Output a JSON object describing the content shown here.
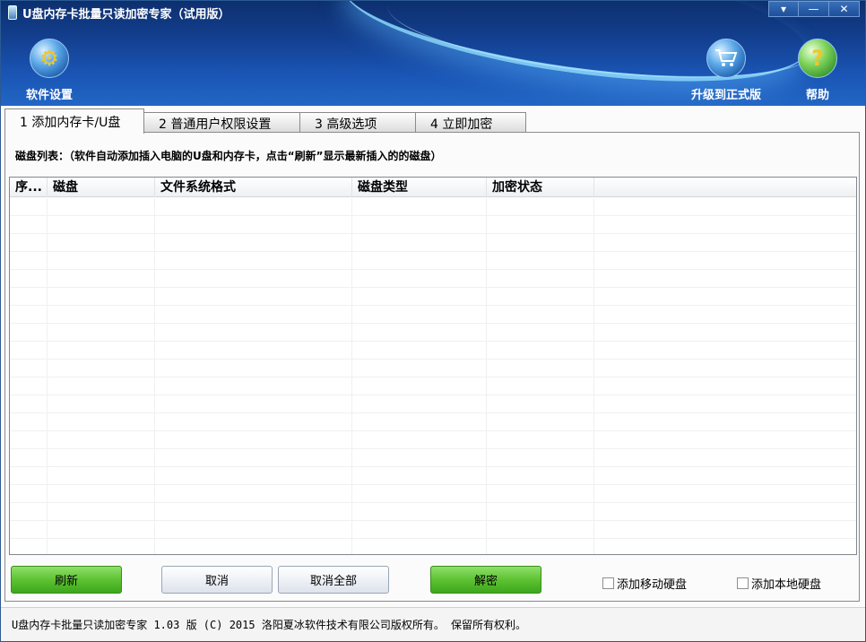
{
  "window": {
    "title": "U盘内存卡批量只读加密专家（试用版）",
    "controls": {
      "menu": "▾",
      "minimize": "—",
      "close": "✕"
    }
  },
  "header": {
    "settings_label": "软件设置",
    "upgrade_label": "升级到正式版",
    "help_label": "帮助"
  },
  "tabs": [
    {
      "label": "1 添加内存卡/U盘"
    },
    {
      "label": "2 普通用户权限设置"
    },
    {
      "label": "3 高级选项"
    },
    {
      "label": "4 立即加密"
    }
  ],
  "panel": {
    "caption": "磁盘列表：（软件自动添加插入电脑的U盘和内存卡，点击“刷新”显示最新插入的的磁盘）"
  },
  "table": {
    "columns": [
      "序...",
      "磁盘",
      "文件系统格式",
      "磁盘类型",
      "加密状态",
      ""
    ],
    "rows": []
  },
  "buttons": {
    "refresh": "刷新",
    "cancel": "取消",
    "cancel_all": "取消全部",
    "decrypt": "解密"
  },
  "checkboxes": {
    "add_removable": {
      "label": "添加移动硬盘",
      "checked": false
    },
    "add_local": {
      "label": "添加本地硬盘",
      "checked": false
    }
  },
  "status": {
    "text": "U盘内存卡批量只读加密专家 1.03 版  (C)  2015 洛阳夏冰软件技术有限公司版权所有。 保留所有权利。"
  },
  "colors": {
    "header_dark": "#0d2f6e",
    "header_light": "#2266c4",
    "green_button": "#5ec233"
  }
}
